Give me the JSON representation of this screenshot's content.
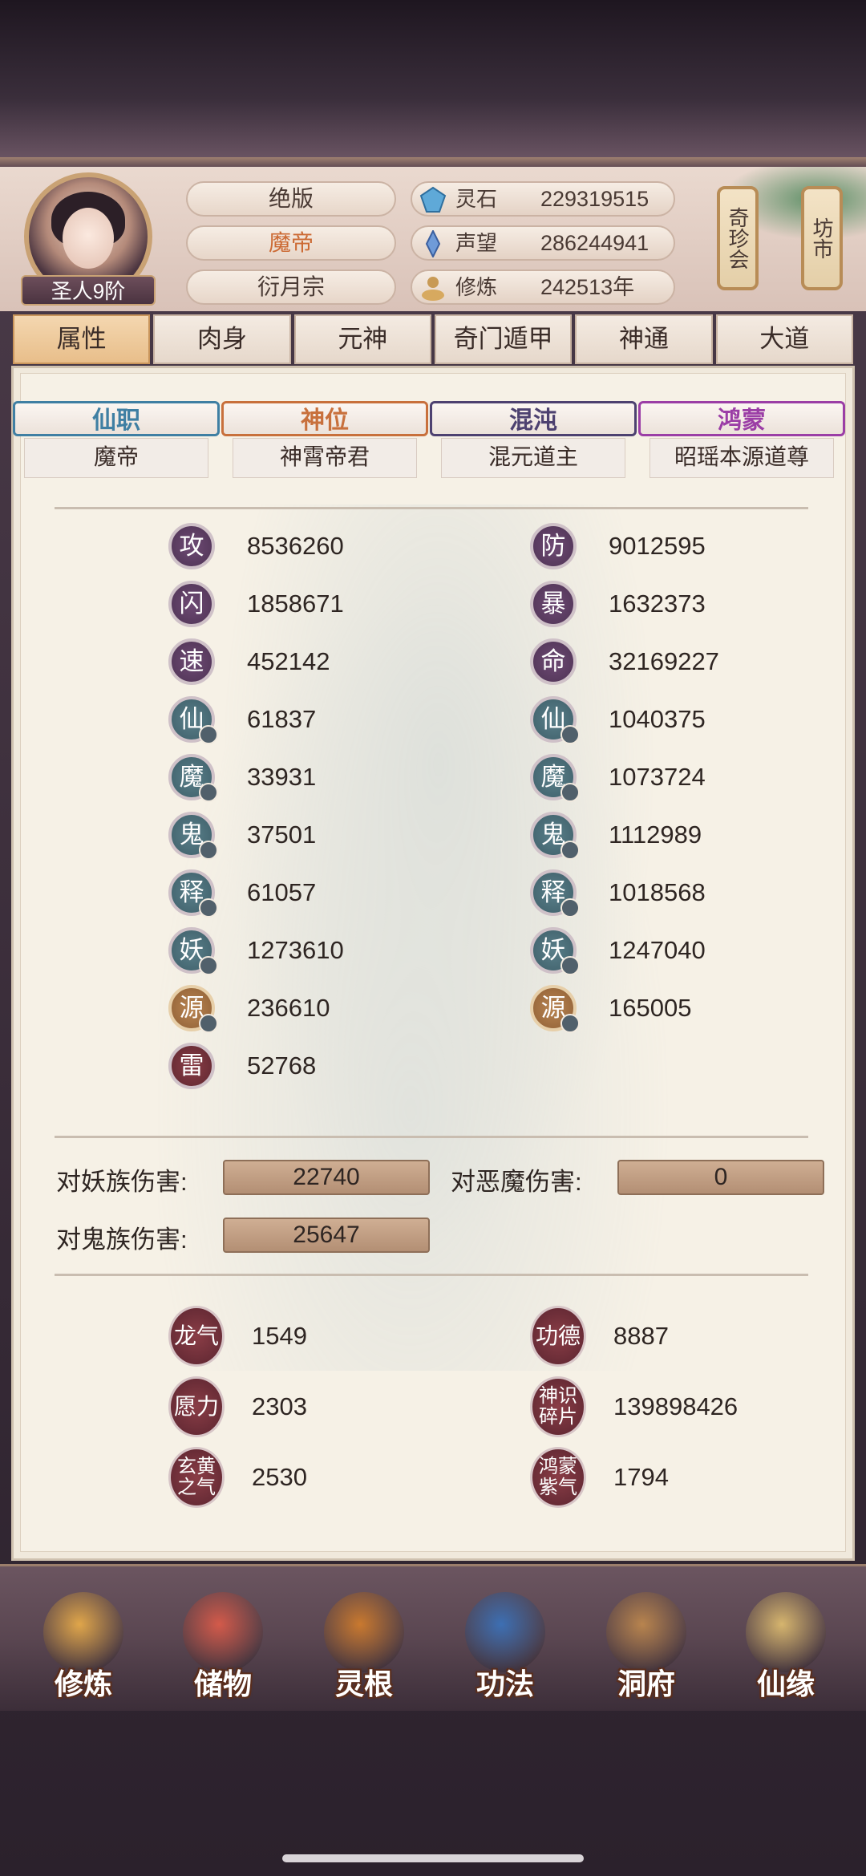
{
  "header": {
    "rank_badge": "圣人9阶",
    "pills": [
      "绝版",
      "魔帝",
      "衍月宗"
    ],
    "resources": [
      {
        "icon": "spirit-stone-icon",
        "label": "灵石",
        "value": "229319515"
      },
      {
        "icon": "prestige-icon",
        "label": "声望",
        "value": "286244941"
      },
      {
        "icon": "cultivation-icon",
        "label": "修炼",
        "value": "242513年"
      }
    ],
    "side_buttons": [
      "奇珍会",
      "坊市"
    ]
  },
  "tabs": [
    "属性",
    "肉身",
    "元神",
    "奇门遁甲",
    "神通",
    "大道"
  ],
  "active_tab": 0,
  "ranks": [
    {
      "head": "仙职",
      "value": "魔帝",
      "color": "#3f7fa3"
    },
    {
      "head": "神位",
      "value": "神霄帝君",
      "color": "#c8703c"
    },
    {
      "head": "混沌",
      "value": "混元道主",
      "color": "#4d4170"
    },
    {
      "head": "鸿蒙",
      "value": "昭瑶本源道尊",
      "color": "#9b3ea6"
    }
  ],
  "stats_left": [
    {
      "icon": "攻",
      "value": "8536260",
      "style": "purple",
      "dot": false
    },
    {
      "icon": "闪",
      "value": "1858671",
      "style": "purple",
      "dot": false
    },
    {
      "icon": "速",
      "value": "452142",
      "style": "purple",
      "dot": false
    },
    {
      "icon": "仙",
      "value": "61837",
      "style": "teal",
      "dot": true
    },
    {
      "icon": "魔",
      "value": "33931",
      "style": "teal",
      "dot": true
    },
    {
      "icon": "鬼",
      "value": "37501",
      "style": "teal",
      "dot": true
    },
    {
      "icon": "释",
      "value": "61057",
      "style": "teal",
      "dot": true
    },
    {
      "icon": "妖",
      "value": "1273610",
      "style": "teal",
      "dot": true
    },
    {
      "icon": "源",
      "value": "236610",
      "style": "gold",
      "dot": true
    },
    {
      "icon": "雷",
      "value": "52768",
      "style": "red",
      "dot": false
    }
  ],
  "stats_right": [
    {
      "icon": "防",
      "value": "9012595",
      "style": "purple",
      "dot": false
    },
    {
      "icon": "暴",
      "value": "1632373",
      "style": "purple",
      "dot": false
    },
    {
      "icon": "命",
      "value": "32169227",
      "style": "purple",
      "dot": false
    },
    {
      "icon": "仙",
      "value": "1040375",
      "style": "teal",
      "dot": true
    },
    {
      "icon": "魔",
      "value": "1073724",
      "style": "teal",
      "dot": true
    },
    {
      "icon": "鬼",
      "value": "1112989",
      "style": "teal",
      "dot": true
    },
    {
      "icon": "释",
      "value": "1018568",
      "style": "teal",
      "dot": true
    },
    {
      "icon": "妖",
      "value": "1247040",
      "style": "teal",
      "dot": true
    },
    {
      "icon": "源",
      "value": "165005",
      "style": "gold",
      "dot": true
    }
  ],
  "damage": [
    {
      "label": "对妖族伤害:",
      "value": "22740"
    },
    {
      "label": "对恶魔伤害:",
      "value": "0"
    },
    {
      "label": "对鬼族伤害:",
      "value": "25647"
    }
  ],
  "special": [
    {
      "icon": "龙气",
      "value": "1549"
    },
    {
      "icon": "功德",
      "value": "8887"
    },
    {
      "icon": "愿力",
      "value": "2303"
    },
    {
      "icon": "神识碎片",
      "value": "139898426"
    },
    {
      "icon": "玄黄之气",
      "value": "2530"
    },
    {
      "icon": "鸿蒙紫气",
      "value": "1794"
    }
  ],
  "bottom_nav": [
    {
      "label": "修炼",
      "icon": "cultivate-icon",
      "color": "#e0a64a"
    },
    {
      "label": "储物",
      "icon": "storage-bag-icon",
      "color": "#d35a4a"
    },
    {
      "label": "灵根",
      "icon": "spirit-root-icon",
      "color": "#c9792f"
    },
    {
      "label": "功法",
      "icon": "technique-book-icon",
      "color": "#3d6fb3"
    },
    {
      "label": "洞府",
      "icon": "cave-mansion-icon",
      "color": "#b8844e"
    },
    {
      "label": "仙缘",
      "icon": "immortal-fate-icon",
      "color": "#d6b56e"
    }
  ]
}
